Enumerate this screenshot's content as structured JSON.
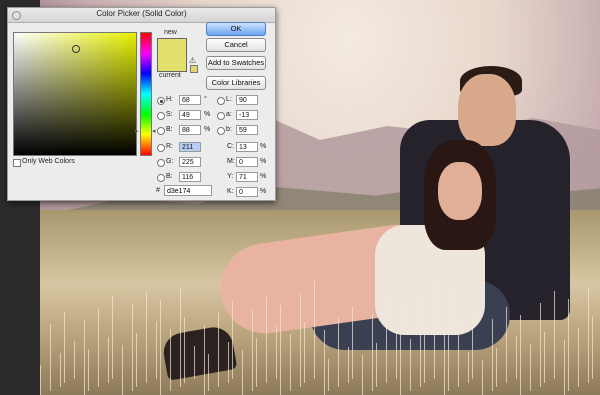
{
  "dialog": {
    "title": "Color Picker (Solid Color)",
    "new_label": "new",
    "current_label": "current",
    "new_color": "#e2e06a",
    "buttons": {
      "ok": "OK",
      "cancel": "Cancel",
      "add_swatches": "Add to Swatches",
      "color_libraries": "Color Libraries"
    },
    "only_web_colors_label": "Only Web Colors",
    "hsb": {
      "h": {
        "label": "H:",
        "value": "68",
        "unit": "°"
      },
      "s": {
        "label": "S:",
        "value": "49",
        "unit": "%"
      },
      "b": {
        "label": "B:",
        "value": "88",
        "unit": "%"
      }
    },
    "rgb": {
      "r": {
        "label": "R:",
        "value": "211"
      },
      "g": {
        "label": "G:",
        "value": "225"
      },
      "b": {
        "label": "B:",
        "value": "116"
      }
    },
    "lab": {
      "l": {
        "label": "L:",
        "value": "90"
      },
      "a": {
        "label": "a:",
        "value": "-13"
      },
      "b": {
        "label": "b:",
        "value": "59"
      }
    },
    "cmyk": {
      "c": {
        "label": "C:",
        "value": "13",
        "unit": "%"
      },
      "m": {
        "label": "M:",
        "value": "0",
        "unit": "%"
      },
      "y": {
        "label": "Y:",
        "value": "71",
        "unit": "%"
      },
      "k": {
        "label": "K:",
        "value": "0",
        "unit": "%"
      }
    },
    "hex": {
      "label": "#",
      "value": "d3e174"
    },
    "selected_mode": "H"
  },
  "icons": {
    "gamut_warning": "gamut-warning-icon",
    "hue_slider_arrow": "triangle-arrow-icon"
  }
}
